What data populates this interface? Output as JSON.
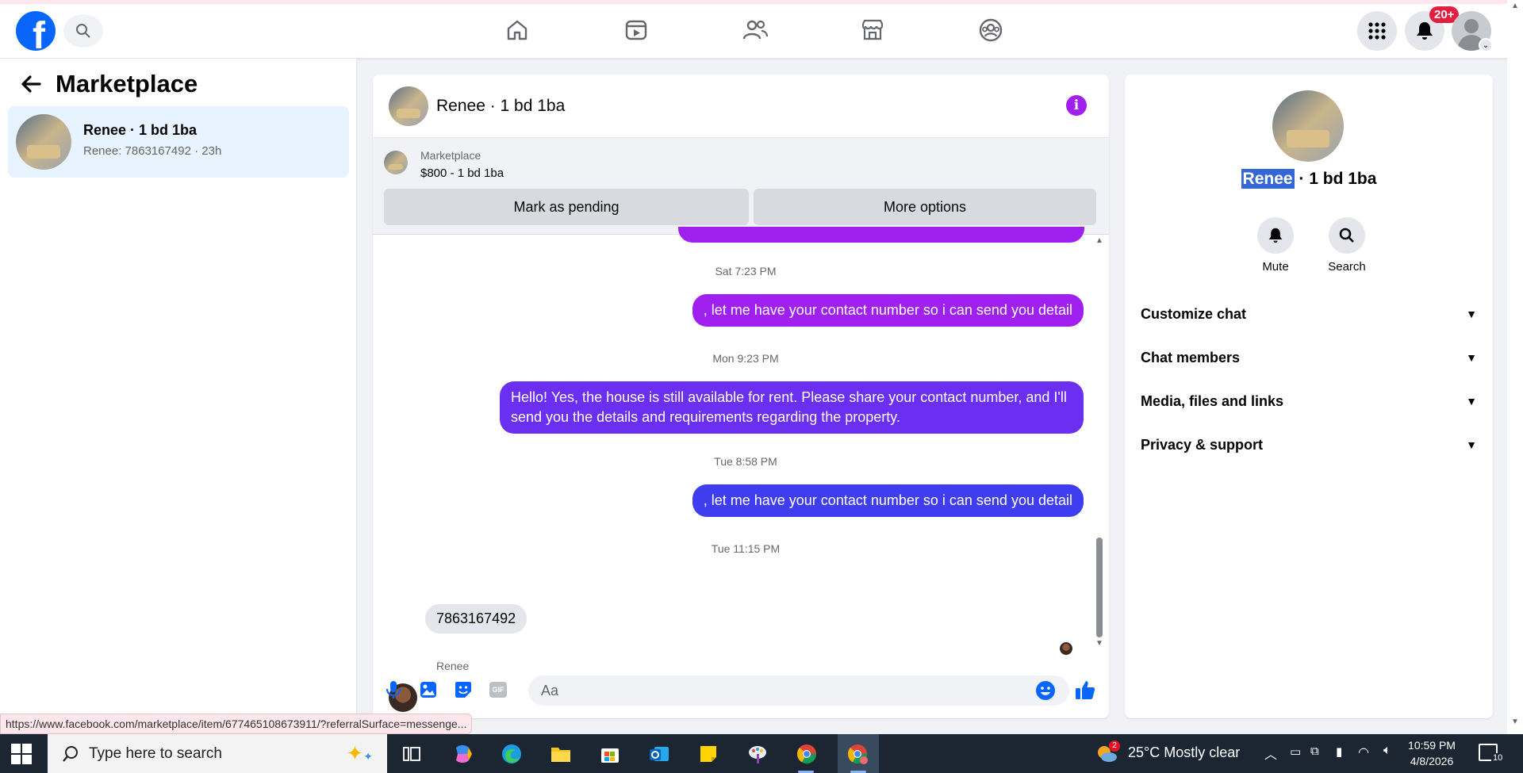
{
  "topbar": {
    "notif_count": "20+",
    "nav_icons": [
      "home-icon",
      "video-icon",
      "friends-icon",
      "marketplace-icon",
      "groups-icon"
    ],
    "right_icons": [
      "menu-grid-icon",
      "bell-icon",
      "avatar"
    ]
  },
  "sidebar": {
    "title": "Marketplace",
    "conversation": {
      "name": "Renee · 1 bd 1ba",
      "preview": "Renee: 7863167492 · 23h"
    }
  },
  "chat": {
    "title": "Renee · 1 bd 1ba",
    "listing": {
      "source": "Marketplace",
      "price_title": "$800 - 1 bd 1ba",
      "mark_pending": "Mark as pending",
      "more_options": "More options"
    },
    "messages": [
      {
        "type": "timestamp",
        "text": "Sat 7:23 PM"
      },
      {
        "type": "outgoing",
        "text": ", let me have your contact number so i can send you detail",
        "color": "#a020f0"
      },
      {
        "type": "timestamp",
        "text": "Mon 9:23 PM"
      },
      {
        "type": "outgoing",
        "text": "Hello! Yes, the house is still available for rent. Please share your contact number, and I'll send you the details and requirements regarding the property.",
        "color": "#6a2ff0"
      },
      {
        "type": "timestamp",
        "text": "Tue 8:58 PM"
      },
      {
        "type": "outgoing",
        "text": ", let me have your contact number so i can send you detail",
        "color": "#3e3ef0"
      },
      {
        "type": "timestamp",
        "text": "Tue 11:15 PM"
      },
      {
        "type": "incoming",
        "sender": "Renee",
        "text": "7863167492"
      }
    ],
    "composer": {
      "placeholder": "Aa",
      "gif_label": "GIF"
    }
  },
  "details": {
    "name_highlight": "Renee",
    "name_rest": " · 1 bd 1ba",
    "actions": [
      {
        "label": "Mute",
        "icon": "bell-icon"
      },
      {
        "label": "Search",
        "icon": "search-icon"
      }
    ],
    "sections": [
      "Customize chat",
      "Chat members",
      "Media, files and links",
      "Privacy & support"
    ]
  },
  "status_url": "https://www.facebook.com/marketplace/item/677465108673911/?referralSurface=messenge...",
  "taskbar": {
    "search_placeholder": "Type here to search",
    "weather": "25°C  Mostly clear",
    "weather_badge": "2",
    "time": "10:59 PM",
    "date": "4/8/2026",
    "notif_count": "10"
  },
  "colors": {
    "fb_blue": "#0866ff",
    "accent_purple": "#a020f0",
    "selection_bg": "#e7f3ff"
  }
}
